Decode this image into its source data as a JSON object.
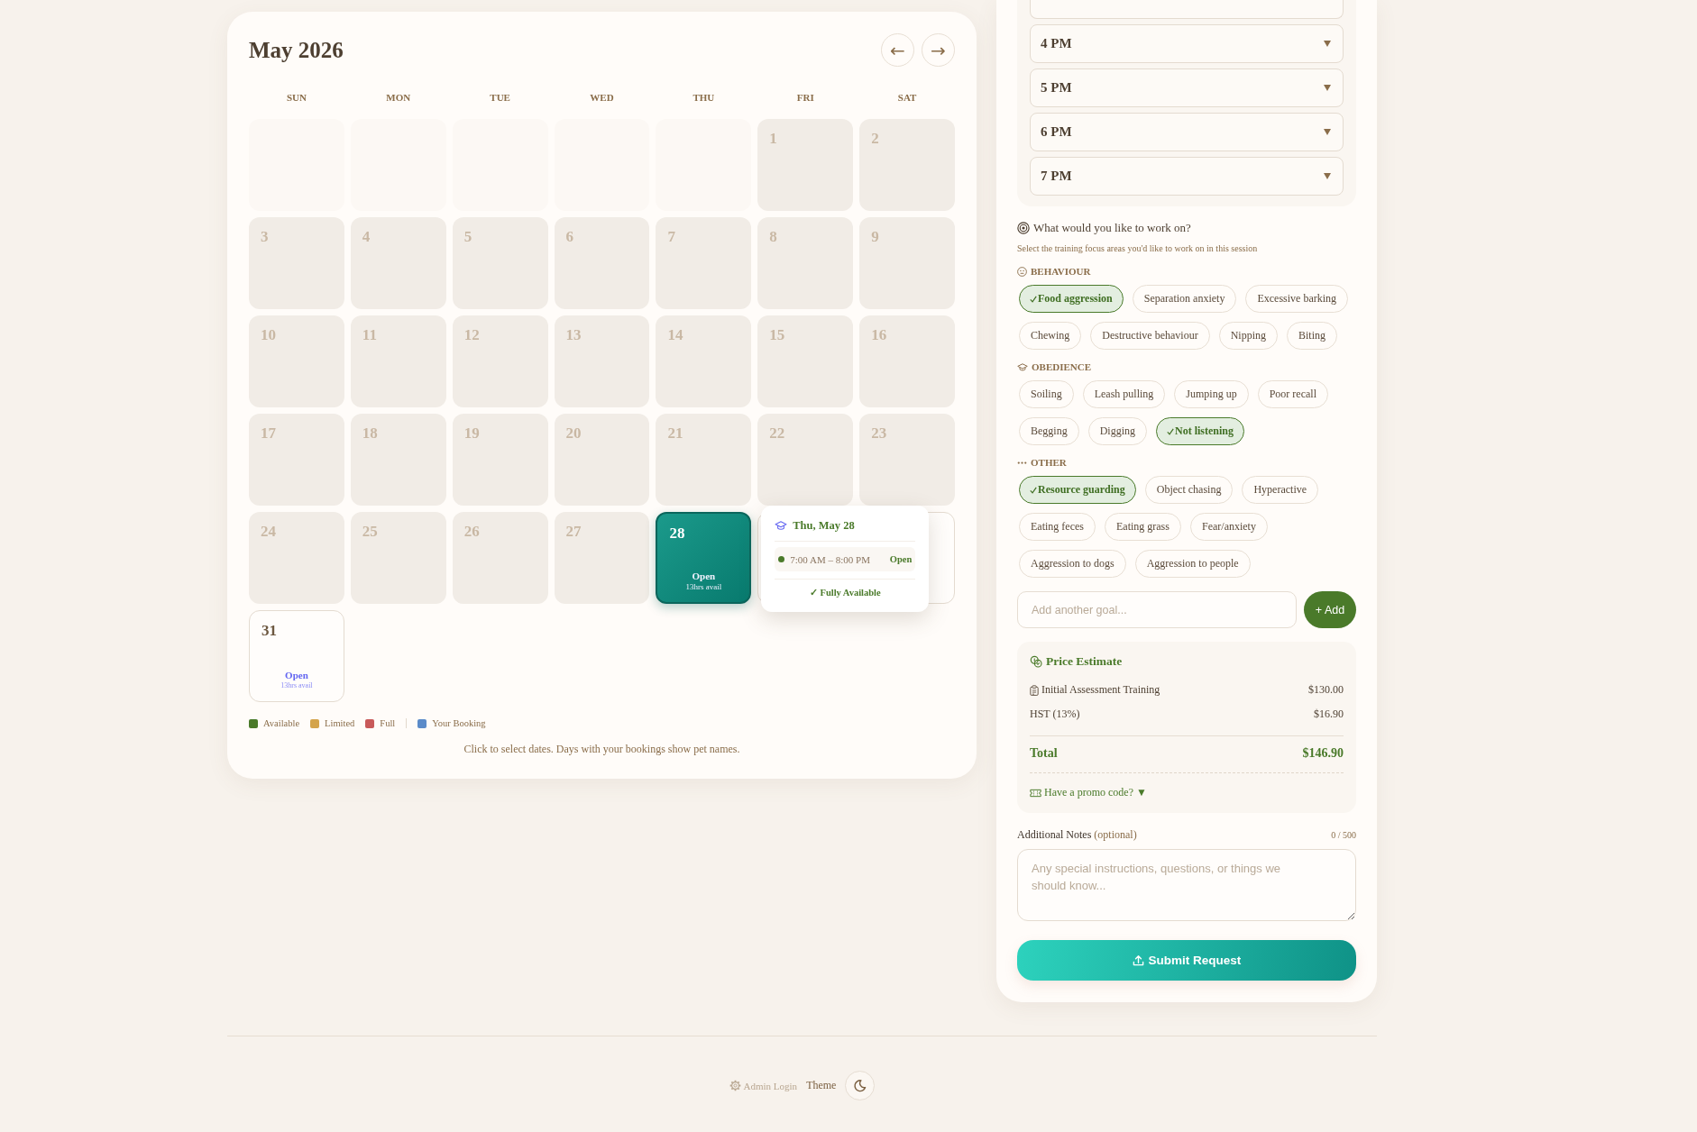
{
  "calendar": {
    "title": "May 2026",
    "nav": [
      {
        "symbol": "←"
      },
      {
        "symbol": "→"
      }
    ],
    "weekdays": [
      "SUN",
      "MON",
      "TUE",
      "WED",
      "THU",
      "FRI",
      "SAT"
    ],
    "days": [
      {
        "kind": "blank"
      },
      {
        "kind": "blank"
      },
      {
        "kind": "blank"
      },
      {
        "kind": "blank"
      },
      {
        "kind": "blank"
      },
      {
        "kind": "past",
        "number": "1",
        "selected": false
      },
      {
        "kind": "past",
        "number": "2",
        "selected": false
      },
      {
        "kind": "past",
        "number": "3",
        "selected": false
      },
      {
        "kind": "past",
        "number": "4",
        "selected": false
      },
      {
        "kind": "past",
        "number": "5",
        "selected": false
      },
      {
        "kind": "past",
        "number": "6",
        "selected": false
      },
      {
        "kind": "past",
        "number": "7",
        "selected": false
      },
      {
        "kind": "past",
        "number": "8",
        "selected": false
      },
      {
        "kind": "past",
        "number": "9",
        "selected": false
      },
      {
        "kind": "past",
        "number": "10",
        "selected": false
      },
      {
        "kind": "past",
        "number": "11",
        "selected": false
      },
      {
        "kind": "past",
        "number": "12",
        "selected": false
      },
      {
        "kind": "past",
        "number": "13",
        "selected": false
      },
      {
        "kind": "past",
        "number": "14",
        "selected": false
      },
      {
        "kind": "past",
        "number": "15",
        "selected": false
      },
      {
        "kind": "past",
        "number": "16",
        "selected": false
      },
      {
        "kind": "past",
        "number": "17",
        "selected": false
      },
      {
        "kind": "past",
        "number": "18",
        "selected": false
      },
      {
        "kind": "past",
        "number": "19",
        "selected": false
      },
      {
        "kind": "past",
        "number": "20",
        "selected": false
      },
      {
        "kind": "past",
        "number": "21",
        "selected": false
      },
      {
        "kind": "past",
        "number": "22",
        "selected": false
      },
      {
        "kind": "past",
        "number": "23",
        "selected": false
      },
      {
        "kind": "past",
        "number": "24",
        "selected": false
      },
      {
        "kind": "past",
        "number": "25",
        "selected": false
      },
      {
        "kind": "past",
        "number": "26",
        "selected": false
      },
      {
        "kind": "past",
        "number": "27",
        "selected": false
      },
      {
        "kind": "open",
        "number": "28",
        "selected": true,
        "status": "Open",
        "hours": "13hrs avail"
      },
      {
        "kind": "open",
        "selected": false
      },
      {
        "kind": "open",
        "selected": false
      },
      {
        "kind": "open",
        "number": "31",
        "selected": false,
        "status": "Open",
        "hours": "13hrs avail"
      }
    ],
    "tooltip": {
      "date": "Thu, May 28",
      "slot_time": "7:00 AM – 8:00 PM",
      "slot_status": "Open",
      "summary": "✓ Fully Available"
    },
    "legend": [
      {
        "kind": "availability",
        "label": "Available",
        "color": "#4a7a2a"
      },
      {
        "kind": "availability",
        "label": "Limited",
        "color": "#d4a44c"
      },
      {
        "kind": "availability",
        "label": "Full",
        "color": "#c85a5a"
      },
      {
        "kind": "booking",
        "label": "Your Booking",
        "color": "#5b8bc9"
      }
    ],
    "note": "Click to select dates. Days with your bookings show pet names."
  },
  "time_slots": [
    {
      "label": "4 PM"
    },
    {
      "label": "5 PM"
    },
    {
      "label": "6 PM"
    },
    {
      "label": "7 PM"
    }
  ],
  "goals": {
    "title": "What would you like to work on?",
    "subtitle": "Select the training focus areas you'd like to work on in this session",
    "groups": [
      {
        "kind": "behaviour",
        "title": "BEHAVIOUR",
        "chips": [
          {
            "label": "Food aggression",
            "selected": true
          },
          {
            "label": "Separation anxiety",
            "selected": false
          },
          {
            "label": "Excessive barking",
            "selected": false
          },
          {
            "label": "Chewing",
            "selected": false
          },
          {
            "label": "Destructive behaviour",
            "selected": false
          },
          {
            "label": "Nipping",
            "selected": false
          },
          {
            "label": "Biting",
            "selected": false
          }
        ]
      },
      {
        "kind": "obedience",
        "title": "OBEDIENCE",
        "chips": [
          {
            "label": "Soiling",
            "selected": false
          },
          {
            "label": "Leash pulling",
            "selected": false
          },
          {
            "label": "Jumping up",
            "selected": false
          },
          {
            "label": "Poor recall",
            "selected": false
          },
          {
            "label": "Begging",
            "selected": false
          },
          {
            "label": "Digging",
            "selected": false
          },
          {
            "label": "Not listening",
            "selected": true
          }
        ]
      },
      {
        "kind": "other",
        "title": "OTHER",
        "chips": [
          {
            "label": "Resource guarding",
            "selected": true
          },
          {
            "label": "Object chasing",
            "selected": false
          },
          {
            "label": "Hyperactive",
            "selected": false
          },
          {
            "label": "Eating feces",
            "selected": false
          },
          {
            "label": "Eating grass",
            "selected": false
          },
          {
            "label": "Fear/anxiety",
            "selected": false
          },
          {
            "label": "Aggression to dogs",
            "selected": false
          },
          {
            "label": "Aggression to people",
            "selected": false
          }
        ]
      }
    ]
  },
  "goal_input": {
    "placeholder": "Add another goal...",
    "button": "+ Add"
  },
  "price": {
    "title": "Price Estimate",
    "items": [
      {
        "kind": "service",
        "label": "Initial Assessment Training",
        "amount": "$130.00"
      },
      {
        "kind": "tax",
        "label": "HST (13%)",
        "amount": "$16.90"
      }
    ],
    "total": {
      "label": "Total",
      "amount": "$146.90"
    },
    "promo": "Have a promo code? ▼"
  },
  "notes": {
    "label": "Additional Notes",
    "hint": "(optional)",
    "counter": "0 / 500",
    "placeholder": "Any special instructions, questions, or things we should know..."
  },
  "submit": {
    "label": "Submit Request"
  },
  "footer": {
    "admin": "Admin Login",
    "theme": "Theme"
  }
}
